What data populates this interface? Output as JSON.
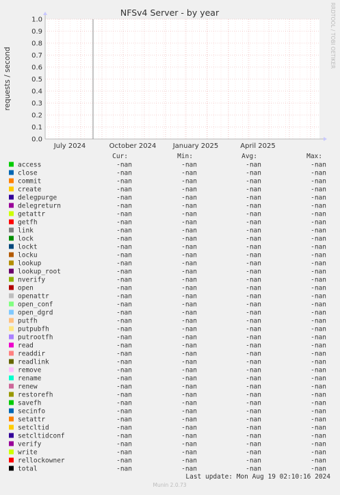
{
  "chart_data": {
    "type": "line",
    "title": "NFSv4 Server - by year",
    "ylabel": "requests / second",
    "xlabel": "",
    "watermark": "RRDTOOL / TOBI OETIKER",
    "y_ticks": [
      "0.0",
      "0.1",
      "0.2",
      "0.3",
      "0.4",
      "0.5",
      "0.6",
      "0.7",
      "0.8",
      "0.9",
      "1.0"
    ],
    "ylim": [
      0,
      1
    ],
    "x_ticks": [
      "July 2024",
      "October 2024",
      "January 2025",
      "April 2025"
    ],
    "grid": true,
    "legend_position": "bottom",
    "legend_headers": [
      "Cur:",
      "Min:",
      "Avg:",
      "Max:"
    ],
    "series": [
      {
        "name": "access",
        "color": "#00cc00",
        "cur": "-nan",
        "min": "-nan",
        "avg": "-nan",
        "max": "-nan"
      },
      {
        "name": "close",
        "color": "#0066b3",
        "cur": "-nan",
        "min": "-nan",
        "avg": "-nan",
        "max": "-nan"
      },
      {
        "name": "commit",
        "color": "#ff8000",
        "cur": "-nan",
        "min": "-nan",
        "avg": "-nan",
        "max": "-nan"
      },
      {
        "name": "create",
        "color": "#ffcc00",
        "cur": "-nan",
        "min": "-nan",
        "avg": "-nan",
        "max": "-nan"
      },
      {
        "name": "delegpurge",
        "color": "#330099",
        "cur": "-nan",
        "min": "-nan",
        "avg": "-nan",
        "max": "-nan"
      },
      {
        "name": "delegreturn",
        "color": "#990099",
        "cur": "-nan",
        "min": "-nan",
        "avg": "-nan",
        "max": "-nan"
      },
      {
        "name": "getattr",
        "color": "#ccff00",
        "cur": "-nan",
        "min": "-nan",
        "avg": "-nan",
        "max": "-nan"
      },
      {
        "name": "getfh",
        "color": "#ff0000",
        "cur": "-nan",
        "min": "-nan",
        "avg": "-nan",
        "max": "-nan"
      },
      {
        "name": "link",
        "color": "#808080",
        "cur": "-nan",
        "min": "-nan",
        "avg": "-nan",
        "max": "-nan"
      },
      {
        "name": "lock",
        "color": "#008f00",
        "cur": "-nan",
        "min": "-nan",
        "avg": "-nan",
        "max": "-nan"
      },
      {
        "name": "lockt",
        "color": "#00487d",
        "cur": "-nan",
        "min": "-nan",
        "avg": "-nan",
        "max": "-nan"
      },
      {
        "name": "locku",
        "color": "#b35a00",
        "cur": "-nan",
        "min": "-nan",
        "avg": "-nan",
        "max": "-nan"
      },
      {
        "name": "lookup",
        "color": "#b38f00",
        "cur": "-nan",
        "min": "-nan",
        "avg": "-nan",
        "max": "-nan"
      },
      {
        "name": "lookup_root",
        "color": "#6b006b",
        "cur": "-nan",
        "min": "-nan",
        "avg": "-nan",
        "max": "-nan"
      },
      {
        "name": "nverify",
        "color": "#8fb300",
        "cur": "-nan",
        "min": "-nan",
        "avg": "-nan",
        "max": "-nan"
      },
      {
        "name": "open",
        "color": "#b30000",
        "cur": "-nan",
        "min": "-nan",
        "avg": "-nan",
        "max": "-nan"
      },
      {
        "name": "openattr",
        "color": "#bebebe",
        "cur": "-nan",
        "min": "-nan",
        "avg": "-nan",
        "max": "-nan"
      },
      {
        "name": "open_conf",
        "color": "#80ff80",
        "cur": "-nan",
        "min": "-nan",
        "avg": "-nan",
        "max": "-nan"
      },
      {
        "name": "open_dgrd",
        "color": "#80c9ff",
        "cur": "-nan",
        "min": "-nan",
        "avg": "-nan",
        "max": "-nan"
      },
      {
        "name": "putfh",
        "color": "#ffc080",
        "cur": "-nan",
        "min": "-nan",
        "avg": "-nan",
        "max": "-nan"
      },
      {
        "name": "putpubfh",
        "color": "#ffe680",
        "cur": "-nan",
        "min": "-nan",
        "avg": "-nan",
        "max": "-nan"
      },
      {
        "name": "putrootfh",
        "color": "#aa80ff",
        "cur": "-nan",
        "min": "-nan",
        "avg": "-nan",
        "max": "-nan"
      },
      {
        "name": "read",
        "color": "#ee00cc",
        "cur": "-nan",
        "min": "-nan",
        "avg": "-nan",
        "max": "-nan"
      },
      {
        "name": "readdir",
        "color": "#ff8080",
        "cur": "-nan",
        "min": "-nan",
        "avg": "-nan",
        "max": "-nan"
      },
      {
        "name": "readlink",
        "color": "#666600",
        "cur": "-nan",
        "min": "-nan",
        "avg": "-nan",
        "max": "-nan"
      },
      {
        "name": "remove",
        "color": "#ffbfff",
        "cur": "-nan",
        "min": "-nan",
        "avg": "-nan",
        "max": "-nan"
      },
      {
        "name": "rename",
        "color": "#00ffcc",
        "cur": "-nan",
        "min": "-nan",
        "avg": "-nan",
        "max": "-nan"
      },
      {
        "name": "renew",
        "color": "#cc6699",
        "cur": "-nan",
        "min": "-nan",
        "avg": "-nan",
        "max": "-nan"
      },
      {
        "name": "restorefh",
        "color": "#999900",
        "cur": "-nan",
        "min": "-nan",
        "avg": "-nan",
        "max": "-nan"
      },
      {
        "name": "savefh",
        "color": "#00cc00",
        "cur": "-nan",
        "min": "-nan",
        "avg": "-nan",
        "max": "-nan"
      },
      {
        "name": "secinfo",
        "color": "#0066b3",
        "cur": "-nan",
        "min": "-nan",
        "avg": "-nan",
        "max": "-nan"
      },
      {
        "name": "setattr",
        "color": "#ff8000",
        "cur": "-nan",
        "min": "-nan",
        "avg": "-nan",
        "max": "-nan"
      },
      {
        "name": "setcltid",
        "color": "#ffcc00",
        "cur": "-nan",
        "min": "-nan",
        "avg": "-nan",
        "max": "-nan"
      },
      {
        "name": "setcltidconf",
        "color": "#330099",
        "cur": "-nan",
        "min": "-nan",
        "avg": "-nan",
        "max": "-nan"
      },
      {
        "name": "verify",
        "color": "#990099",
        "cur": "-nan",
        "min": "-nan",
        "avg": "-nan",
        "max": "-nan"
      },
      {
        "name": "write",
        "color": "#ccff00",
        "cur": "-nan",
        "min": "-nan",
        "avg": "-nan",
        "max": "-nan"
      },
      {
        "name": "rellockowner",
        "color": "#ff0000",
        "cur": "-nan",
        "min": "-nan",
        "avg": "-nan",
        "max": "-nan"
      },
      {
        "name": "total",
        "color": "#000000",
        "cur": "-nan",
        "min": "-nan",
        "avg": "-nan",
        "max": "-nan"
      }
    ],
    "last_update": "Last update: Mon Aug 19 02:10:16 2024",
    "footer": "Munin 2.0.73"
  }
}
